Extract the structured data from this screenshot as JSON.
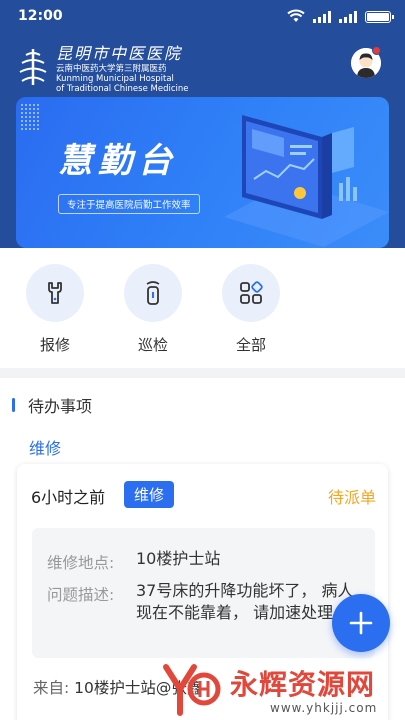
{
  "status_bar": {
    "time": "12:00"
  },
  "brand": {
    "name_cn": "昆明市中医医院",
    "line1": "云南中医药大学第三附属医药",
    "line2": "Kunming Municipal Hospital",
    "line3": "of Traditional Chinese Medicine"
  },
  "banner": {
    "title": "慧勤台",
    "subtitle": "专注于提高医院后勤工作效率"
  },
  "quick_actions": [
    {
      "label": "报修",
      "icon": "wrench-icon"
    },
    {
      "label": "巡检",
      "icon": "inspection-device-icon"
    },
    {
      "label": "全部",
      "icon": "grid-apps-icon"
    }
  ],
  "todo": {
    "section_title": "待办事项",
    "category": "维修",
    "card": {
      "time": "6小时之前",
      "tag": "维修",
      "status": "待派单",
      "location_label": "维修地点:",
      "location": "10楼护士站",
      "problem_label": "问题描述:",
      "problem": "37号床的升降功能坏了， 病人现在不能靠着， 请加速处理",
      "from_label": "来自:",
      "from": "10楼护士站@张鑫"
    }
  },
  "fab": {
    "icon": "plus-icon"
  },
  "watermark": {
    "text": "永辉资源网",
    "url": "www.yhkjjj.com"
  },
  "colors": {
    "header_bg": "#244e9c",
    "accent": "#2b6ef0",
    "status_pending": "#f5a623",
    "watermark": "#e1473a"
  }
}
